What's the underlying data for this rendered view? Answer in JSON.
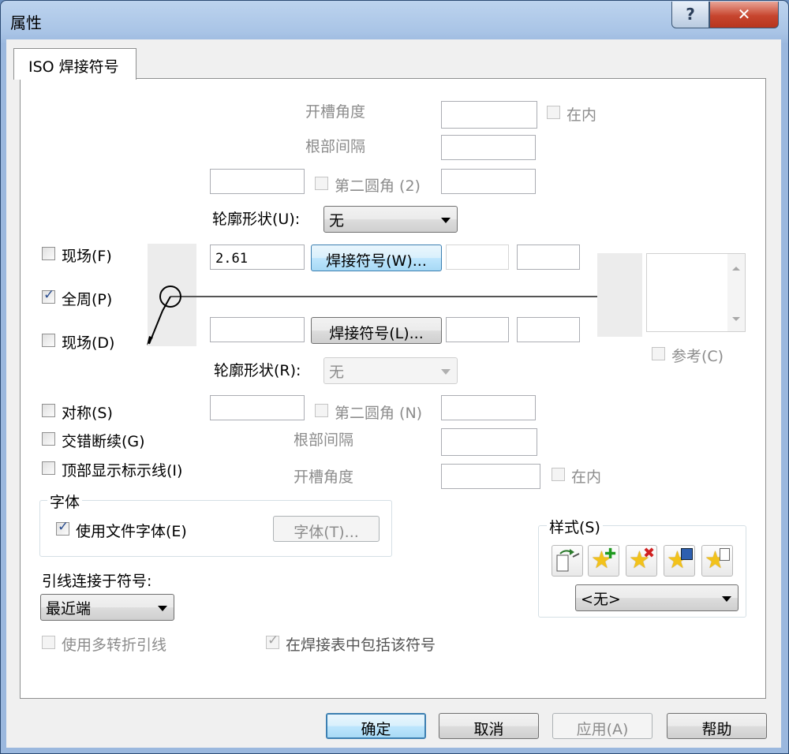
{
  "window": {
    "title": "属性",
    "help_glyph": "?",
    "close_glyph": "✕"
  },
  "tab": {
    "label": "ISO 焊接符号"
  },
  "top": {
    "groove_angle": "开槽角度",
    "root_gap": "根部间隔",
    "inside": "在内",
    "second_fillet": "第二圆角 (2)",
    "contour_label": "轮廓形状(U):",
    "contour_value": "无",
    "size_value": "2.61",
    "weld_button": "焊接符号(W)..."
  },
  "bottom": {
    "weld_button": "焊接符号(L)...",
    "contour_label": "轮廓形状(R):",
    "contour_value": "无",
    "second_fillet": "第二圆角 (N)",
    "root_gap": "根部间隔",
    "groove_angle": "开槽角度",
    "inside": "在内"
  },
  "left": {
    "field_top": "现场(F)",
    "all_around": "全周(P)",
    "field_bottom": "现场(D)",
    "symmetric": "对称(S)",
    "staggered": "交错断续(G)",
    "show_top_line": "顶部显示标示线(I)"
  },
  "right": {
    "reference": "参考(C)"
  },
  "font_group": {
    "title": "字体",
    "use_doc_font": "使用文件字体(E)",
    "font_button": "字体(T)..."
  },
  "leader": {
    "label": "引线连接于符号:",
    "value": "最近端",
    "multi_jog": "使用多转折引线",
    "include_table": "在焊接表中包括该符号"
  },
  "style_group": {
    "title": "样式(S)",
    "value": "<无>"
  },
  "checks": {
    "field_top": false,
    "all_around": true,
    "field_bottom": false,
    "symmetric": false,
    "staggered": false,
    "show_top_line": false,
    "use_doc_font": true,
    "multi_jog": false,
    "include_table": true,
    "top_inside": false,
    "bottom_inside": false,
    "top_second_fillet": false,
    "bottom_second_fillet": false,
    "reference": false
  },
  "footer": {
    "ok": "确定",
    "cancel": "取消",
    "apply": "应用(A)",
    "help": "帮助"
  },
  "colors": {
    "accent": "#3c7fb1",
    "disabled_text": "#8c8c8c",
    "checkmark": "#2a4d8f"
  }
}
